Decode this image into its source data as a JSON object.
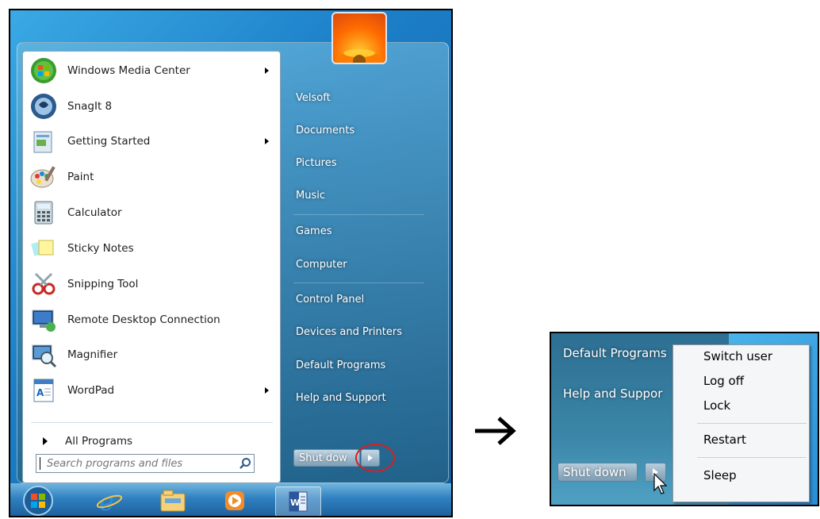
{
  "start_menu": {
    "programs": [
      {
        "label": "Windows Media Center",
        "icon": "windows-media-center-icon",
        "submenu": true
      },
      {
        "label": "SnagIt 8",
        "icon": "snagit-icon",
        "submenu": false
      },
      {
        "label": "Getting Started",
        "icon": "getting-started-icon",
        "submenu": true
      },
      {
        "label": "Paint",
        "icon": "paint-icon",
        "submenu": false
      },
      {
        "label": "Calculator",
        "icon": "calculator-icon",
        "submenu": false
      },
      {
        "label": "Sticky Notes",
        "icon": "sticky-notes-icon",
        "submenu": false
      },
      {
        "label": "Snipping Tool",
        "icon": "snipping-tool-icon",
        "submenu": false
      },
      {
        "label": "Remote Desktop Connection",
        "icon": "remote-desktop-icon",
        "submenu": false
      },
      {
        "label": "Magnifier",
        "icon": "magnifier-icon",
        "submenu": false
      },
      {
        "label": "WordPad",
        "icon": "wordpad-icon",
        "submenu": true
      }
    ],
    "all_programs": "All Programs",
    "search_placeholder": "Search programs and files",
    "right_links": [
      "Velsoft",
      "Documents",
      "Pictures",
      "Music",
      "Games",
      "Computer",
      "Control Panel",
      "Devices and Printers",
      "Default Programs",
      "Help and Support"
    ],
    "shutdown_label": "Shut down",
    "shutdown_label_visible": "Shut dow"
  },
  "taskbar": {
    "items": [
      "start-orb-icon",
      "internet-explorer-icon",
      "windows-explorer-icon",
      "media-player-icon",
      "word-icon"
    ]
  },
  "zoom": {
    "links": [
      "Default Programs",
      "Help and Support"
    ],
    "links_visible": [
      "Default Programs",
      "Help and Suppor"
    ],
    "shutdown_label": "Shut down",
    "menu": [
      "Switch user",
      "Log off",
      "Lock",
      "Restart",
      "Sleep"
    ]
  },
  "colors": {
    "highlight_circle": "#d62020",
    "taskbar": "#2f7fbf"
  }
}
